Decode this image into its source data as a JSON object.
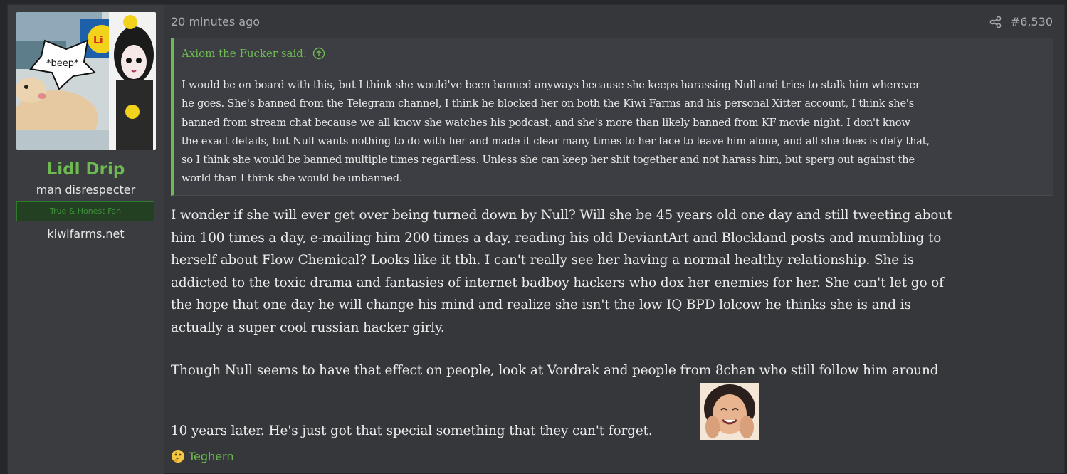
{
  "post": {
    "timestamp": "20 minutes ago",
    "post_number": "#6,530",
    "share_icon": "share-icon"
  },
  "author": {
    "avatar_text": "*beep*",
    "avatar_badge": "LIDL",
    "name": "Lidl Drip",
    "title": "man disrespecter",
    "banner": "True & Honest Fan",
    "site": "kiwifarms.net",
    "name_color": "#6dbb50"
  },
  "quote": {
    "author_said": "Axiom the Fucker said:",
    "lines": [
      "I would be on board with this, but I think she would've been banned anyways because she keeps harassing Null and tries to stalk him wherever",
      "he goes. She's banned from the Telegram channel, I think he blocked her on both the Kiwi Farms and his personal Xitter account, I think she's",
      "banned from stream chat because we all know she watches his podcast, and she's more than likely banned from KF movie night. I don't know",
      "the exact details, but Null wants nothing to do with her and made it clear many times to her face to leave him alone, and all she does is defy that,",
      "so I think she would be banned multiple times regardless. Unless she can keep her shit together and not harass him, but sperg out against the",
      "world than I think she would be unbanned."
    ]
  },
  "message": {
    "para1_lines": [
      "I wonder if she will ever get over being turned down by Null? Will she be 45 years old one day and still tweeting about",
      "him 100 times a day, e-mailing him 200 times a day, reading his old DeviantArt and Blockland posts and mumbling to",
      "herself about Flow Chemical? Looks like it tbh. I can't really see her having a normal healthy relationship. She is",
      "addicted to the toxic drama and fantasies of internet badboy hackers who dox her enemies for her. She can't let go of",
      "the hope that one day he will change his mind and realize she isn't the low IQ BPD lolcow he thinks she is and is",
      "actually a super cool russian hacker girly."
    ],
    "para2": "Though Null seems to have that effect on people, look at Vordrak and people from 8chan who still follow him around",
    "para3": "10 years later. He's just got that special something that they can't forget."
  },
  "reactions": {
    "user": "Teghern",
    "icon": "thinking-face-icon"
  }
}
